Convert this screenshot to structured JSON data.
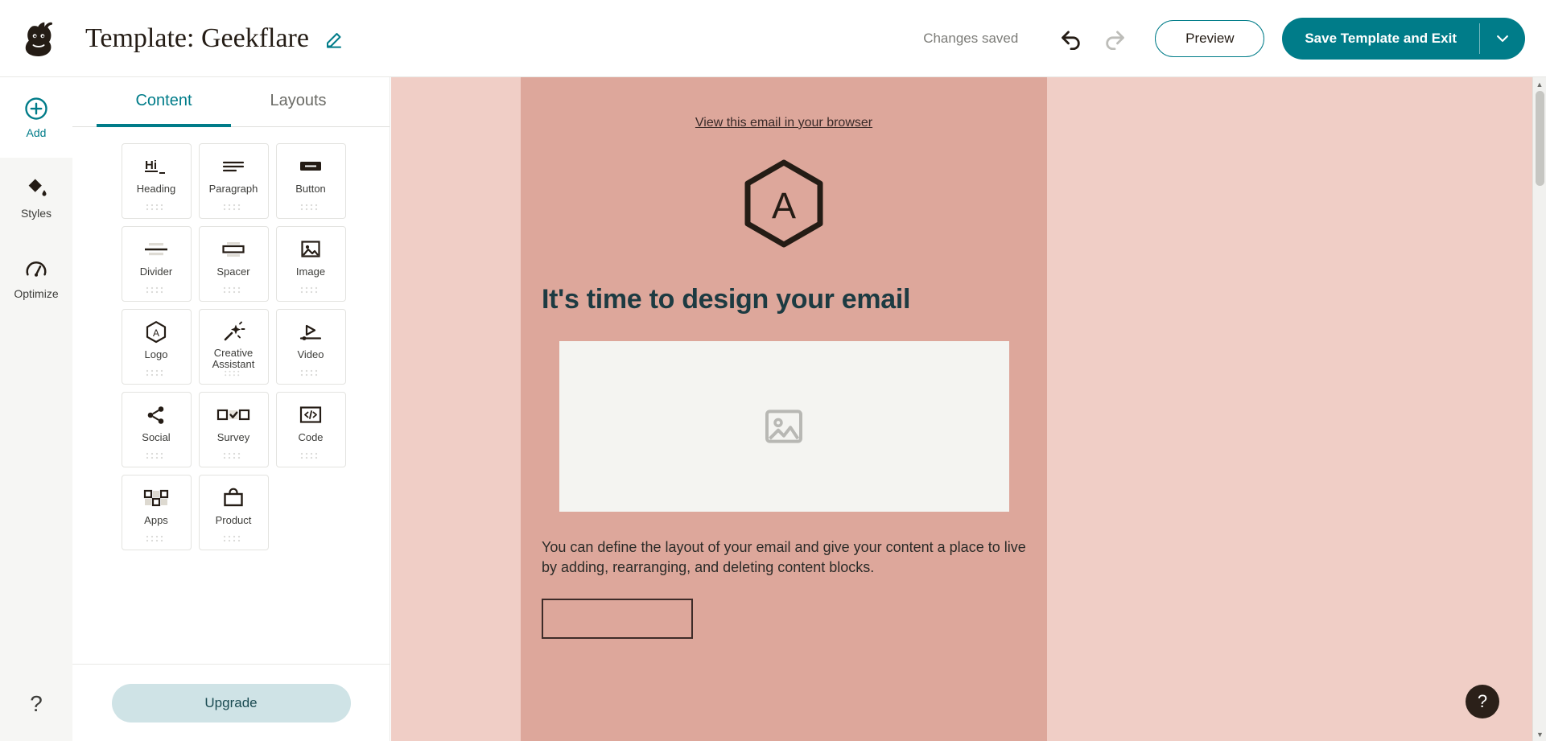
{
  "topbar": {
    "title": "Template: Geekflare",
    "edit_icon": "pencil-icon",
    "status": "Changes saved",
    "undo_icon": "undo-arrow-icon",
    "redo_icon": "redo-arrow-icon",
    "preview_label": "Preview",
    "save_label": "Save Template and Exit",
    "save_caret_icon": "chevron-down-icon",
    "accent_color": "#007c89"
  },
  "rail": {
    "items": [
      {
        "label": "Add",
        "icon": "plus-circle-icon",
        "active": true
      },
      {
        "label": "Styles",
        "icon": "paint-bucket-icon",
        "active": false
      },
      {
        "label": "Optimize",
        "icon": "gauge-icon",
        "active": false
      }
    ],
    "help_label": "?"
  },
  "panel": {
    "tabs": [
      {
        "label": "Content",
        "active": true
      },
      {
        "label": "Layouts",
        "active": false
      }
    ],
    "blocks": [
      {
        "label": "Heading",
        "icon": "heading-hi-icon"
      },
      {
        "label": "Paragraph",
        "icon": "paragraph-lines-icon"
      },
      {
        "label": "Button",
        "icon": "button-icon"
      },
      {
        "label": "Divider",
        "icon": "divider-icon"
      },
      {
        "label": "Spacer",
        "icon": "spacer-icon"
      },
      {
        "label": "Image",
        "icon": "image-icon"
      },
      {
        "label": "Logo",
        "icon": "logo-hexagon-a-icon"
      },
      {
        "label": "Creative Assistant",
        "icon": "magic-wand-icon"
      },
      {
        "label": "Video",
        "icon": "video-play-icon"
      },
      {
        "label": "Social",
        "icon": "share-nodes-icon"
      },
      {
        "label": "Survey",
        "icon": "survey-checkbox-icon"
      },
      {
        "label": "Code",
        "icon": "code-brackets-icon"
      },
      {
        "label": "Apps",
        "icon": "apps-grid-icon"
      },
      {
        "label": "Product",
        "icon": "shopping-bag-icon"
      }
    ],
    "drag_handle_icon": "drag-dots-icon",
    "upgrade_label": "Upgrade"
  },
  "canvas": {
    "preheader": "View this email in your browser",
    "logo_letter": "A",
    "logo_icon": "hexagon-logo-icon",
    "heading": "It's time to design your email",
    "image_placeholder_icon": "image-placeholder-icon",
    "body_text": "You can define the layout of your email and give your content a place to live by adding, rearranging, and deleting content blocks.",
    "outer_bg": "#f0cec6",
    "email_bg": "#dda79b"
  },
  "help_fab": {
    "label": "?"
  },
  "scrollbar": {
    "up_icon": "caret-up-icon",
    "down_icon": "caret-down-icon"
  }
}
